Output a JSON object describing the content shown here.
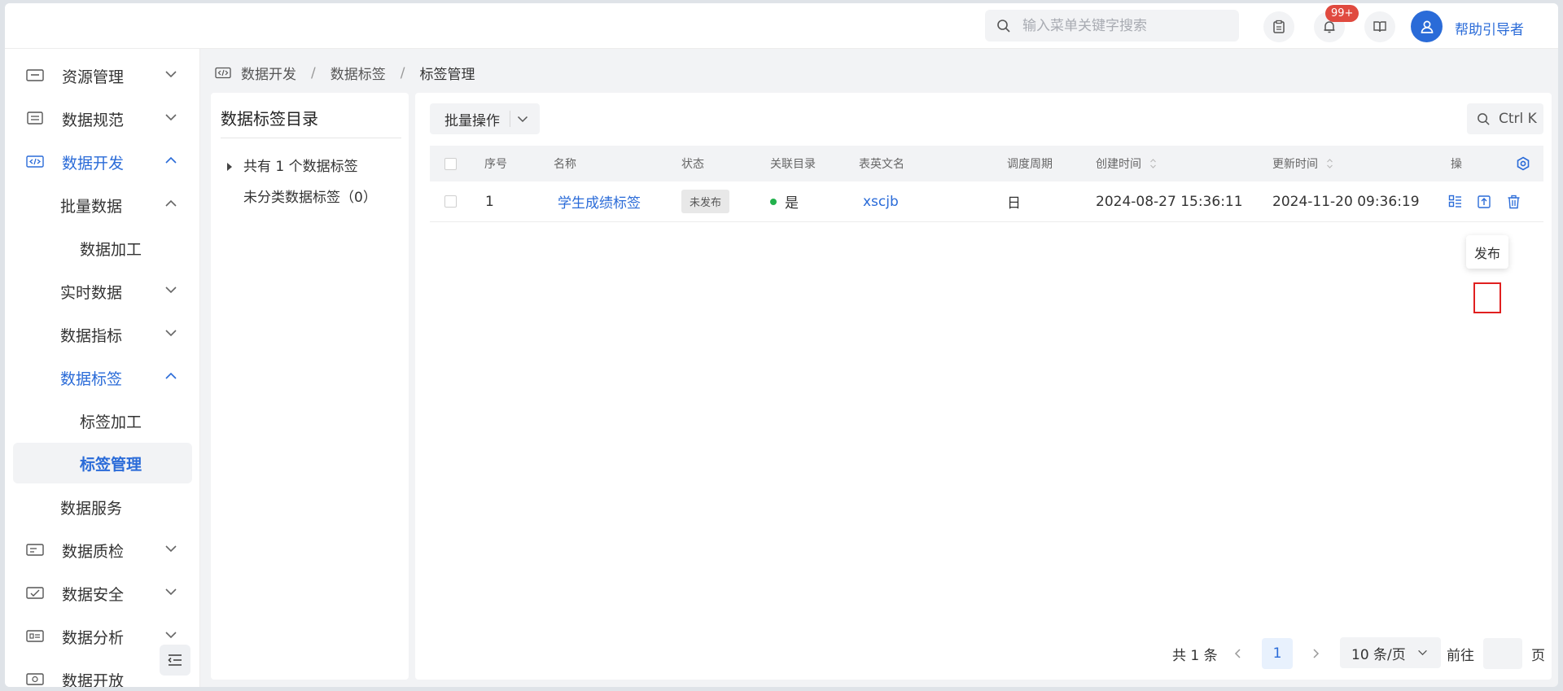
{
  "header": {
    "search_placeholder": "输入菜单关键字搜索",
    "notification_badge": "99+",
    "user_name": "帮助引导者"
  },
  "sidebar": {
    "items": [
      {
        "label": "资源管理",
        "icon": "resource-icon"
      },
      {
        "label": "数据规范",
        "icon": "standard-icon"
      },
      {
        "label": "数据开发",
        "icon": "code-icon"
      },
      {
        "label": "批量数据"
      },
      {
        "label": "数据加工"
      },
      {
        "label": "实时数据"
      },
      {
        "label": "数据指标"
      },
      {
        "label": "数据标签"
      },
      {
        "label": "标签加工"
      },
      {
        "label": "标签管理"
      },
      {
        "label": "数据服务"
      },
      {
        "label": "数据质检",
        "icon": "quality-icon"
      },
      {
        "label": "数据安全",
        "icon": "security-icon"
      },
      {
        "label": "数据分析",
        "icon": "analysis-icon"
      },
      {
        "label": "数据开放",
        "icon": "open-icon"
      }
    ]
  },
  "breadcrumb": {
    "items": [
      "数据开发",
      "数据标签",
      "标签管理"
    ]
  },
  "tree": {
    "title": "数据标签目录",
    "root_label": "共有 1 个数据标签",
    "child_label": "未分类数据标签（0）"
  },
  "toolbar": {
    "batch_label": "批量操作",
    "shortcut_label": "Ctrl K"
  },
  "table": {
    "columns": [
      "序号",
      "名称",
      "状态",
      "关联目录",
      "表英文名",
      "调度周期",
      "创建时间",
      "更新时间",
      "操"
    ],
    "rows": [
      {
        "index": "1",
        "name": "学生成绩标签",
        "status": "未发布",
        "linked": "是",
        "table_name": "xscjb",
        "cycle": "日",
        "created": "2024-08-27 15:36:11",
        "updated": "2024-11-20 09:36:19"
      }
    ]
  },
  "tooltip": {
    "text": "发布"
  },
  "pagination": {
    "total": "共 1 条",
    "current_page": "1",
    "page_size": "10 条/页",
    "goto_label": "前往",
    "page_suffix": "页"
  },
  "colors": {
    "accent": "#2a6bd8",
    "badge": "#e04a3f",
    "status_dot": "#22b14c",
    "highlight": "#e02020"
  }
}
